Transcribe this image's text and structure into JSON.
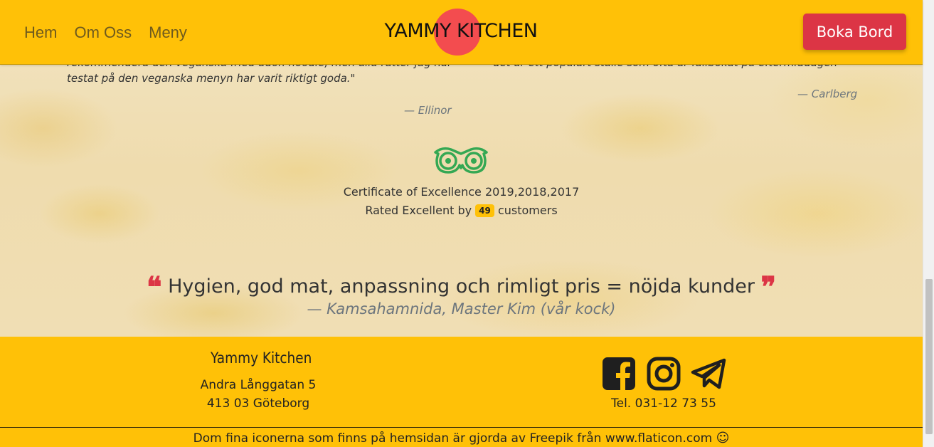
{
  "navbar": {
    "links": [
      "Hem",
      "Om Oss",
      "Meny"
    ],
    "brand": "YAMMY KITCHEN",
    "cta": "Boka Bord",
    "colors": {
      "bar": "#ffc107",
      "cta": "#dc3545",
      "logo_circle": "#f34c4f"
    }
  },
  "reviews": {
    "left_line1": "rekommendera den veganska fried udon noodle, men alla rätter jag har",
    "left_line2": "testat på den veganska menyn har varit riktigt goda.\"",
    "left_author": "— Ellinor",
    "right_line1": "det är ett populärt ställe som ofta är fullbokat på eftermiddagen",
    "right_author": "— Carlberg"
  },
  "tripadvisor": {
    "icon": "owl-icon",
    "certificate": "Certificate of Excellence 2019,2018,2017",
    "rated_prefix": "Rated Excellent by",
    "rated_count": "49",
    "rated_suffix": "customers"
  },
  "featured_quote": {
    "text": "Hygien, god mat, anpassning och rimligt pris = nöjda kunder",
    "author": "— Kamsahamnida, Master Kim (vår kock)"
  },
  "footer": {
    "name": "Yammy Kitchen",
    "address_line1": "Andra Långgatan 5",
    "address_line2": "413 03 Göteborg",
    "social_icons": [
      "facebook-icon",
      "instagram-icon",
      "telegram-icon"
    ],
    "tel": "Tel. 031-12 73 55",
    "credit": "Dom fina iconerna som finns på hemsidan är gjorda av Freepik från www.flaticon.com",
    "credit_emoji": "☺"
  }
}
